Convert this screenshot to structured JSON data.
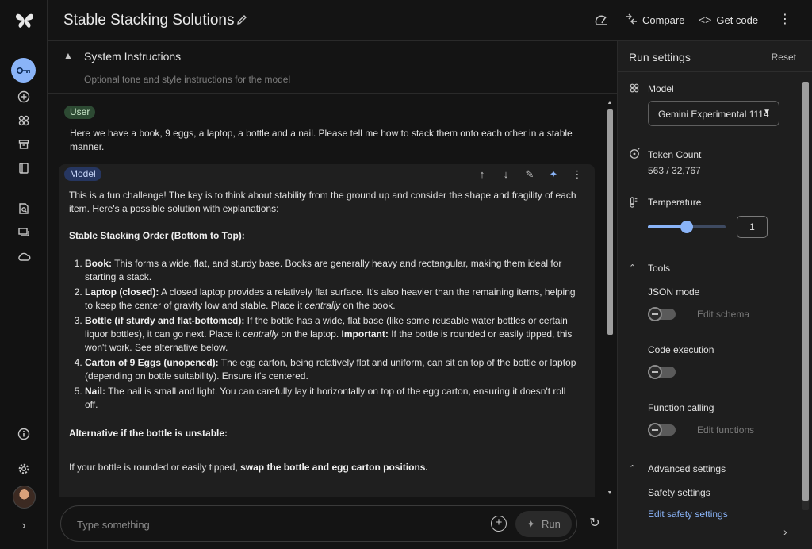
{
  "header": {
    "title": "Stable Stacking Solutions",
    "compare_label": "Compare",
    "get_code_label": "Get code"
  },
  "system_instructions": {
    "label": "System Instructions",
    "placeholder": "Optional tone and style instructions for the model"
  },
  "user_message": {
    "role": "User",
    "text": "Here we have a book, 9 eggs, a laptop, a bottle and a nail. Please tell me how to stack them onto each other in a stable manner."
  },
  "model_message": {
    "role": "Model",
    "intro": "This is a fun challenge! The key is to think about stability from the ground up and consider the shape and fragility of each item. Here's a possible solution with explanations:",
    "heading": "Stable Stacking Order (Bottom to Top):",
    "items": [
      {
        "title": "Book:",
        "text": " This forms a wide, flat, and sturdy base. Books are generally heavy and rectangular, making them ideal for starting a stack."
      },
      {
        "title": "Laptop (closed):",
        "text_a": " A closed laptop provides a relatively flat surface. It's also heavier than the remaining items, helping to keep the center of gravity low and stable. Place it ",
        "em": "centrally",
        "text_b": " on the book."
      },
      {
        "title": "Bottle (if sturdy and flat-bottomed):",
        "text_a": " If the bottle has a wide, flat base (like some reusable water bottles or certain liquor bottles), it can go next. Place it ",
        "em": "centrally",
        "text_b": " on the laptop. ",
        "strong": "Important:",
        "text_c": " If the bottle is rounded or easily tipped, this won't work. See alternative below."
      },
      {
        "title": "Carton of 9 Eggs (unopened):",
        "text": " The egg carton, being relatively flat and uniform, can sit on top of the bottle or laptop (depending on bottle suitability). Ensure it's centered."
      },
      {
        "title": "Nail:",
        "text": " The nail is small and light. You can carefully lay it horizontally on top of the egg carton, ensuring it doesn't roll off."
      }
    ],
    "alt_heading": "Alternative if the bottle is unstable:",
    "alt_text": "If your bottle is rounded or easily tipped, ",
    "alt_strong": "swap the bottle and egg carton positions."
  },
  "input": {
    "placeholder": "Type something",
    "run_label": "Run"
  },
  "settings": {
    "title": "Run settings",
    "reset_label": "Reset",
    "model_label": "Model",
    "model_value": "Gemini Experimental 1114",
    "token_label": "Token Count",
    "token_value": "563 / 32,767",
    "temperature_label": "Temperature",
    "temperature_value": "1",
    "temperature_fraction": 0.5,
    "tools_label": "Tools",
    "json_mode_label": "JSON mode",
    "edit_schema_label": "Edit schema",
    "code_execution_label": "Code execution",
    "function_calling_label": "Function calling",
    "edit_functions_label": "Edit functions",
    "advanced_label": "Advanced settings",
    "safety_label": "Safety settings",
    "edit_safety_label": "Edit safety settings"
  },
  "colors": {
    "accent": "#8ab4f8",
    "user_badge": "#2d4a33",
    "model_badge": "#263660"
  }
}
